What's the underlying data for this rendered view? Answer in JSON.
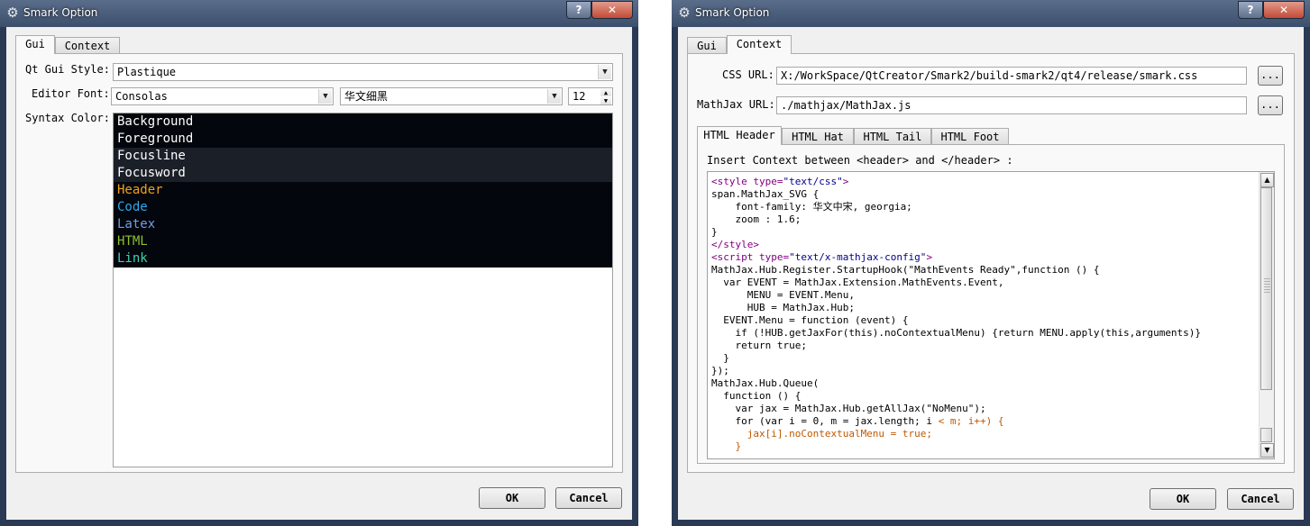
{
  "window_title": "Smark Option",
  "help_glyph": "?",
  "close_glyph": "✕",
  "icons": {
    "gear": "gear-icon",
    "combo_arrow": "chevron-down-icon",
    "spin_up": "chevron-up-icon",
    "spin_down": "chevron-down-icon"
  },
  "tabs": {
    "gui": "Gui",
    "context": "Context"
  },
  "gui": {
    "style_label": "Qt Gui Style:",
    "style_value": "Plastique",
    "font_label": "Editor Font:",
    "font_value": "Consolas",
    "cjk_font_value": "华文细黑",
    "font_size": "12",
    "syntax_label": "Syntax Color:",
    "syntax_items": [
      {
        "label": "Background",
        "color": "#ffffff"
      },
      {
        "label": "Foreground",
        "color": "#ffffff"
      },
      {
        "label": "Focusline",
        "color": "#ffffff"
      },
      {
        "label": "Focusword",
        "color": "#ffffff"
      },
      {
        "label": "Header",
        "color": "#f0a01e"
      },
      {
        "label": "Code",
        "color": "#2fa8e8"
      },
      {
        "label": "Latex",
        "color": "#6f9fe8"
      },
      {
        "label": "HTML",
        "color": "#8ec02a"
      },
      {
        "label": "Link",
        "color": "#3ad4b0"
      }
    ]
  },
  "context": {
    "css_label": "CSS URL:",
    "css_value": "X:/WorkSpace/QtCreator/Smark2/build-smark2/qt4/release/smark.css",
    "mathjax_label": "MathJax URL:",
    "mathjax_value": "./mathjax/MathJax.js",
    "browse_label": "...",
    "html_tabs": [
      "HTML Header",
      "HTML Hat",
      "HTML Tail",
      "HTML Foot"
    ],
    "insert_hint": "Insert Context between <header> and </header> :",
    "code_lines": [
      "<style type=\"text/css\">",
      "span.MathJax_SVG {",
      "    font-family: 华文中宋, georgia;",
      "    zoom : 1.6;",
      "}",
      "</style>",
      "<script type=\"text/x-mathjax-config\">",
      "MathJax.Hub.Register.StartupHook(\"MathEvents Ready\",function () {",
      "  var EVENT = MathJax.Extension.MathEvents.Event,",
      "      MENU = EVENT.Menu,",
      "      HUB = MathJax.Hub;",
      "  EVENT.Menu = function (event) {",
      "    if (!HUB.getJaxFor(this).noContextualMenu) {return MENU.apply(this,arguments)}",
      "    return true;",
      "  }",
      "});",
      "MathJax.Hub.Queue(",
      "  function () {",
      "    var jax = MathJax.Hub.getAllJax(\"NoMenu\");",
      "    for (var i = 0, m = jax.length; i < m; i++) {",
      "      jax[i].noContextualMenu = true;",
      "    }"
    ]
  },
  "buttons": {
    "ok": "OK",
    "cancel": "Cancel"
  },
  "colors": {
    "tag": "#800080",
    "string": "#00008b",
    "operator": "#c05800"
  }
}
